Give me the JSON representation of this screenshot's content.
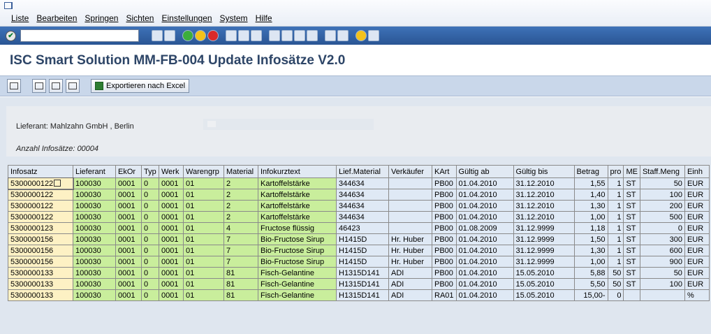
{
  "menu": [
    "Liste",
    "Bearbeiten",
    "Springen",
    "Sichten",
    "Einstellungen",
    "System",
    "Hilfe"
  ],
  "title": "ISC Smart Solution MM-FB-004 Update Infosätze V2.0",
  "appbar": {
    "export_label": "Exportieren nach Excel"
  },
  "info": {
    "lieferant": "Lieferant: Mahlzahn GmbH , Berlin",
    "anzahl": "Anzahl Infosätze: 00004"
  },
  "columns": [
    "Infosatz",
    "Lieferant",
    "EkOr",
    "Typ",
    "Werk",
    "Warengrp",
    "Material",
    "Infokurztext",
    "Lief.Material",
    "Verkäufer",
    "KArt",
    "Gültig ab",
    "Gültig bis",
    "Betrag",
    "pro",
    "ME",
    "Staff.Meng",
    "Einh"
  ],
  "rows": [
    [
      "5300000122",
      "100030",
      "0001",
      "0",
      "0001",
      "01",
      "2",
      "Kartoffelstärke",
      "344634",
      "",
      "PB00",
      "01.04.2010",
      "31.12.2010",
      "1,55",
      "1",
      "ST",
      "50",
      "EUR"
    ],
    [
      "5300000122",
      "100030",
      "0001",
      "0",
      "0001",
      "01",
      "2",
      "Kartoffelstärke",
      "344634",
      "",
      "PB00",
      "01.04.2010",
      "31.12.2010",
      "1,40",
      "1",
      "ST",
      "100",
      "EUR"
    ],
    [
      "5300000122",
      "100030",
      "0001",
      "0",
      "0001",
      "01",
      "2",
      "Kartoffelstärke",
      "344634",
      "",
      "PB00",
      "01.04.2010",
      "31.12.2010",
      "1,30",
      "1",
      "ST",
      "200",
      "EUR"
    ],
    [
      "5300000122",
      "100030",
      "0001",
      "0",
      "0001",
      "01",
      "2",
      "Kartoffelstärke",
      "344634",
      "",
      "PB00",
      "01.04.2010",
      "31.12.2010",
      "1,00",
      "1",
      "ST",
      "500",
      "EUR"
    ],
    [
      "5300000123",
      "100030",
      "0001",
      "0",
      "0001",
      "01",
      "4",
      "Fructose flüssig",
      "46423",
      "",
      "PB00",
      "01.08.2009",
      "31.12.9999",
      "1,18",
      "1",
      "ST",
      "0",
      "EUR"
    ],
    [
      "5300000156",
      "100030",
      "0001",
      "0",
      "0001",
      "01",
      "7",
      "Bio-Fructose Sirup",
      "H1415D",
      "Hr. Huber",
      "PB00",
      "01.04.2010",
      "31.12.9999",
      "1,50",
      "1",
      "ST",
      "300",
      "EUR"
    ],
    [
      "5300000156",
      "100030",
      "0001",
      "0",
      "0001",
      "01",
      "7",
      "Bio-Fructose Sirup",
      "H1415D",
      "Hr. Huber",
      "PB00",
      "01.04.2010",
      "31.12.9999",
      "1,30",
      "1",
      "ST",
      "600",
      "EUR"
    ],
    [
      "5300000156",
      "100030",
      "0001",
      "0",
      "0001",
      "01",
      "7",
      "Bio-Fructose Sirup",
      "H1415D",
      "Hr. Huber",
      "PB00",
      "01.04.2010",
      "31.12.9999",
      "1,00",
      "1",
      "ST",
      "900",
      "EUR"
    ],
    [
      "5300000133",
      "100030",
      "0001",
      "0",
      "0001",
      "01",
      "81",
      "Fisch-Gelantine",
      "H1315D141",
      "ADI",
      "PB00",
      "01.04.2010",
      "15.05.2010",
      "5,88",
      "50",
      "ST",
      "50",
      "EUR"
    ],
    [
      "5300000133",
      "100030",
      "0001",
      "0",
      "0001",
      "01",
      "81",
      "Fisch-Gelantine",
      "H1315D141",
      "ADI",
      "PB00",
      "01.04.2010",
      "15.05.2010",
      "5,50",
      "50",
      "ST",
      "100",
      "EUR"
    ],
    [
      "5300000133",
      "100030",
      "0001",
      "0",
      "0001",
      "01",
      "81",
      "Fisch-Gelantine",
      "H1315D141",
      "ADI",
      "RA01",
      "01.04.2010",
      "15.05.2010",
      "15,00-",
      "0",
      "",
      "",
      "%"
    ]
  ]
}
